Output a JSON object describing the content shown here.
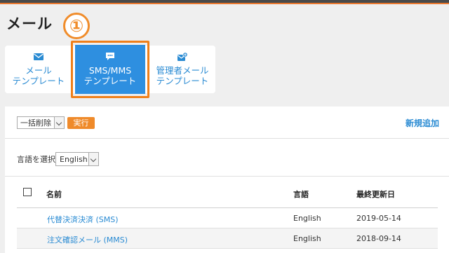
{
  "page": {
    "title": "メール",
    "step_badge": "①"
  },
  "tabs": [
    {
      "line1": "メール",
      "line2": "テンプレート",
      "icon": "envelope-icon",
      "active": false
    },
    {
      "line1": "SMS/MMS",
      "line2": "テンプレート",
      "icon": "chat-bubble-icon",
      "active": true
    },
    {
      "line1": "管理者メール",
      "line2": "テンプレート",
      "icon": "admin-mail-icon",
      "active": false
    }
  ],
  "toolbar": {
    "bulk_select_value": "一括削除",
    "exec_label": "実行",
    "new_label": "新規追加"
  },
  "language": {
    "label": "言語を選択:",
    "selected": "English"
  },
  "table": {
    "headers": {
      "name": "名前",
      "language": "言語",
      "updated": "最終更新日"
    },
    "rows": [
      {
        "name": "代替決済決済 (SMS)",
        "language": "English",
        "updated": "2019-05-14"
      },
      {
        "name": "注文確認メール (MMS)",
        "language": "English",
        "updated": "2018-09-14"
      }
    ]
  },
  "colors": {
    "accent": "#2e8fe0",
    "highlight": "#ef7f1a",
    "link": "#2a8bd3",
    "row_alt": "#f4f4f4"
  }
}
